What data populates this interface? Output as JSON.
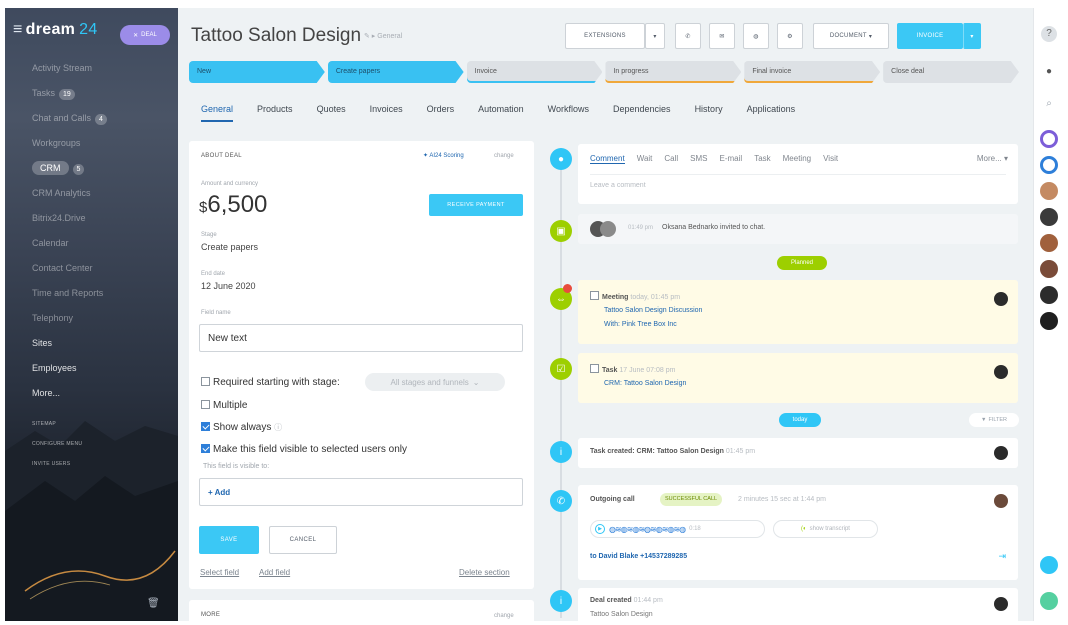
{
  "sidebar": {
    "logo_main": "dream",
    "logo_num": "24",
    "deal_badge": "DEAL",
    "items": [
      {
        "label": "Activity Stream",
        "count": ""
      },
      {
        "label": "Tasks",
        "count": "19"
      },
      {
        "label": "Chat and Calls",
        "count": "4"
      },
      {
        "label": "Workgroups",
        "count": ""
      },
      {
        "label": "CRM",
        "count": "5"
      },
      {
        "label": "CRM Analytics",
        "count": ""
      },
      {
        "label": "Bitrix24.Drive",
        "count": ""
      },
      {
        "label": "Calendar",
        "count": ""
      },
      {
        "label": "Contact Center",
        "count": ""
      },
      {
        "label": "Time and Reports",
        "count": ""
      },
      {
        "label": "Telephony",
        "count": ""
      },
      {
        "label": "Sites",
        "count": ""
      },
      {
        "label": "Employees",
        "count": ""
      },
      {
        "label": "More...",
        "count": ""
      }
    ],
    "small_links": [
      "SITEMAP",
      "CONFIGURE MENU",
      "INVITE USERS"
    ]
  },
  "header": {
    "title": "Tattoo Salon  Design",
    "subtitle": "General",
    "buttons": {
      "extensions": "EXTENSIONS",
      "document": "DOCUMENT",
      "invoice": "INVOICE"
    }
  },
  "stages": [
    "New",
    "Create papers",
    "Invoice",
    "In progress",
    "Final invoice",
    "Close deal"
  ],
  "stage_accent_colors": [
    "#39c1f2",
    "#39c1f2",
    "#39c1f2",
    "#f0a83a",
    "#f0a83a",
    "#9aa3ad"
  ],
  "tabs": [
    "General",
    "Products",
    "Quotes",
    "Invoices",
    "Orders",
    "Automation",
    "Workflows",
    "Dependencies",
    "History",
    "Applications"
  ],
  "about": {
    "section_title": "ABOUT DEAL",
    "scoring": "AI24 Scoring",
    "change": "change",
    "amount_label": "Amount and currency",
    "currency": "$",
    "amount": "6,500",
    "receive_payment": "RECEIVE PAYMENT",
    "stage_label": "Stage",
    "stage_value": "Create papers",
    "end_date_label": "End date",
    "end_date_value": "12 June 2020",
    "field_name_label": "Field name",
    "field_value": "New text",
    "opt_required": "Required starting with stage:",
    "stages_select": "All stages and funnels",
    "opt_multiple": "Multiple",
    "opt_show_always": "Show always",
    "opt_visible": "Make this field visible to selected users only",
    "visible_to_label": "This field is visible to:",
    "add": "+ Add",
    "save": "SAVE",
    "cancel": "CANCEL",
    "select_field": "Select field",
    "add_field": "Add field",
    "delete_section": "Delete section",
    "more_title": "MORE",
    "more_change": "change"
  },
  "timeline": {
    "composer_tabs": [
      "Comment",
      "Wait",
      "Call",
      "SMS",
      "E-mail",
      "Task",
      "Meeting",
      "Visit"
    ],
    "more": "More...",
    "placeholder": "Leave a comment",
    "chat_time": "01:49 pm",
    "chat_text": "Oksana Bednarko invited to chat.",
    "planned": "Planned",
    "meeting_title": "Meeting",
    "meeting_time": "today, 01:45 pm",
    "meeting_line1": "Tattoo Salon Design Discussion",
    "meeting_line2": "With: Pink Tree Box Inc",
    "task_title": "Task",
    "task_time": "17 June 07:08 pm",
    "task_line": "CRM: Tattoo Salon Design",
    "today": "today",
    "filter": "FILTER",
    "task_created": "Task created: CRM: Tattoo Salon Design",
    "task_created_time": "01:45 pm",
    "call_title": "Outgoing call",
    "call_badge": "SUCCESSFUL CALL",
    "call_meta": "2 minutes 15 sec at 1:44 pm",
    "call_duration": "0:18",
    "call_transcript": "show transcript",
    "call_to": "to David Blake +14537289285",
    "deal_created": "Deal created",
    "deal_created_time": "01:44 pm",
    "deal_created_sub": "Tattoo Salon Design"
  },
  "colors": {
    "accent": "#3bc8f5",
    "link": "#2067b0",
    "green": "#9dcf00",
    "meeting_bg": "#fffbe6"
  }
}
